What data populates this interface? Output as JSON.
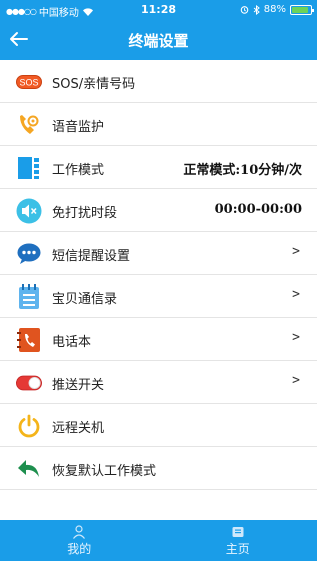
{
  "status": {
    "carrier": "中国移动",
    "time": "11:28",
    "battery": "88%",
    "battery_level": 0.88
  },
  "header": {
    "title": "终端设置"
  },
  "settings": {
    "items": [
      {
        "label": "SOS/亲情号码",
        "icon": "sos-icon"
      },
      {
        "label": "语音监护",
        "icon": "voice-monitor-icon"
      },
      {
        "label": "工作模式",
        "value": "正常模式:10分钟/次",
        "icon": "work-mode-icon"
      },
      {
        "label": "免打扰时段",
        "value": "00:00-00:00",
        "icon": "mute-icon"
      },
      {
        "label": "短信提醒设置",
        "arrow": ">",
        "icon": "sms-icon"
      },
      {
        "label": "宝贝通信录",
        "arrow": ">",
        "icon": "contacts-icon"
      },
      {
        "label": "电话本",
        "arrow": ">",
        "icon": "phonebook-icon"
      },
      {
        "label": "推送开关",
        "arrow": ">",
        "icon": "toggle-icon"
      },
      {
        "label": "远程关机",
        "icon": "power-icon"
      },
      {
        "label": "恢复默认工作模式",
        "icon": "restore-icon"
      }
    ]
  },
  "tabs": {
    "mine": "我的",
    "home": "主页"
  },
  "colors": {
    "primary": "#1a9de8",
    "divider": "#e4e4e4"
  }
}
